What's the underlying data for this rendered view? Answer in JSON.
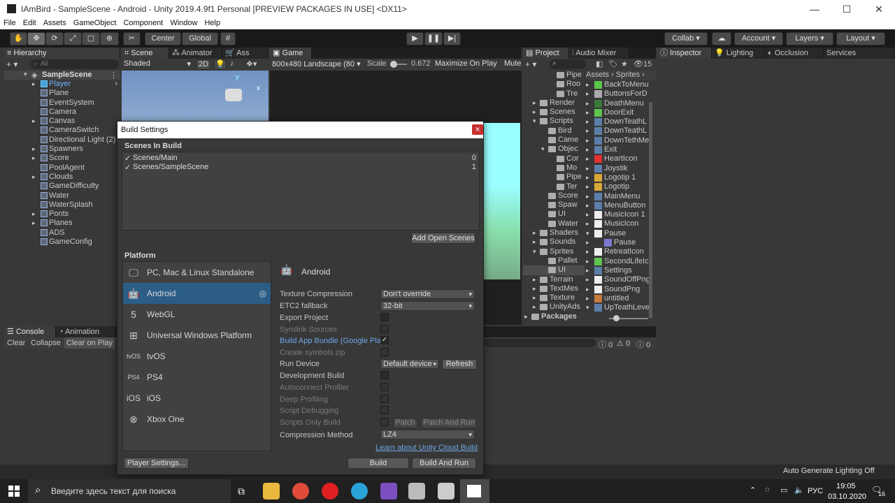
{
  "window": {
    "title": "IAmBird - SampleScene - Android - Unity 2019.4.9f1 Personal [PREVIEW PACKAGES IN USE] <DX11>",
    "minimize": "—",
    "maximize": "☐",
    "close": "✕"
  },
  "menu": [
    "File",
    "Edit",
    "Assets",
    "GameObject",
    "Component",
    "Window",
    "Help"
  ],
  "toolbar": {
    "center": "Center",
    "global": "Global",
    "collab": "Collab ▾",
    "account": "Account",
    "layers": "Layers",
    "layout": "Layout"
  },
  "hierarchy": {
    "tab": "Hierarchy",
    "search_placeholder": "All",
    "scene": "SampleScene",
    "items": [
      "Player",
      "Plane",
      "EventSystem",
      "Camera",
      "Canvas",
      "CameraSwitch",
      "Directional Light (2)",
      "Spawners",
      "Score",
      "PoolAgent",
      "Clouds",
      "GameDifficulty",
      "Water",
      "WaterSplash",
      "Ponts",
      "Planes",
      "ADS",
      "GameConfig"
    ]
  },
  "scene_view": {
    "tab_scene": "Scene",
    "tab_animator": "Animator",
    "tab_asset": "Ass",
    "shaded": "Shaded",
    "mode_2d": "2D",
    "gizmo_y": "y",
    "gizmo_x": "x"
  },
  "game_view": {
    "tab": "Game",
    "resolution": "800x480 Landscape (80",
    "scale_label": "Scale",
    "scale_value": "0.672",
    "maximize": "Maximize On Play",
    "mute": "Mute"
  },
  "project": {
    "tab_project": "Project",
    "tab_audio": "Audio Mixer",
    "count": "15",
    "breadcrumb_assets": "Assets",
    "breadcrumb_sprites": "Sprites",
    "tree": [
      "Pipe",
      "Roo",
      "Tre",
      "Render",
      "Scenes",
      "Scripts",
      "Bird",
      "Came",
      "Objec",
      "Cor",
      "Mo",
      "Pipe",
      "Ter",
      "Score",
      "Spaw",
      "UI",
      "Water",
      "Shaders",
      "Sounds",
      "Sprites",
      "Pallet",
      "UI",
      "Terrain",
      "TextMes",
      "Texture",
      "UnityAds",
      "Packages"
    ],
    "assets": [
      "BackToMenu",
      "ButtonsForD",
      "DeathMenu",
      "DoorExit",
      "DownTeathL",
      "DownTeathL",
      "DownTethMe",
      "Exit",
      "HeartIcon",
      "Joystik",
      "Logotip 1",
      "Logotip",
      "MainMenu",
      "MenuButton",
      "MusicIcon 1",
      "MusicIcon",
      "Pause",
      "Pause",
      "RetreatIcon",
      "SecondLifeIc",
      "Settings",
      "SoundOffPng",
      "SoundPng",
      "untitled",
      "UpTeathLeve"
    ]
  },
  "inspector": {
    "tab_inspector": "Inspector",
    "tab_lighting": "Lighting",
    "tab_occlusion": "Occlusion",
    "tab_services": "Services"
  },
  "console": {
    "tab_console": "Console",
    "tab_animation": "Animation",
    "clear": "Clear",
    "collapse": "Collapse",
    "clear_on_play": "Clear on Play",
    "count_errors": "0",
    "count_warnings": "0",
    "count_logs": "0"
  },
  "status": {
    "auto_lighting": "Auto Generate Lighting Off"
  },
  "build_settings": {
    "title": "Build Settings",
    "close": "×",
    "scenes_header": "Scenes In Build",
    "scenes": [
      {
        "name": "Scenes/Main",
        "index": "0"
      },
      {
        "name": "Scenes/SampleScene",
        "index": "1"
      }
    ],
    "add_open_scenes": "Add Open Scenes",
    "platform_header": "Platform",
    "platforms": [
      "PC, Mac & Linux Standalone",
      "Android",
      "WebGL",
      "Universal Windows Platform",
      "tvOS",
      "PS4",
      "iOS",
      "Xbox One"
    ],
    "platform_icons": [
      "🖵",
      "🤖",
      "5",
      "⊞",
      "tvOS",
      "PS4",
      "iOS",
      "⊗"
    ],
    "selected_platform": "Android",
    "fields": {
      "texture_compression": "Texture Compression",
      "texture_compression_value": "Don't override",
      "etc2_fallback": "ETC2 fallback",
      "etc2_value": "32-bit",
      "export_project": "Export Project",
      "symlink_sources": "Symlink Sources",
      "build_app_bundle": "Build App Bundle (Google Play)",
      "create_symbols": "Create symbols.zip",
      "run_device": "Run Device",
      "run_device_value": "Default device",
      "refresh": "Refresh",
      "development_build": "Development Build",
      "autoconnect_profiler": "Autoconnect Profiler",
      "deep_profiling": "Deep Profiling",
      "script_debugging": "Script Debugging",
      "scripts_only_build": "Scripts Only Build",
      "patch": "Patch",
      "patch_and_run": "Patch And Run",
      "compression_method": "Compression Method",
      "compression_value": "LZ4",
      "cloud_build_link": "Learn about Unity Cloud Build"
    },
    "player_settings": "Player Settings...",
    "build": "Build",
    "build_and_run": "Build And Run"
  },
  "taskbar": {
    "search_placeholder": "Введите здесь текст для поиска",
    "lang": "РУС",
    "time": "19:05",
    "date": "03.10.2020",
    "notif": "16"
  }
}
